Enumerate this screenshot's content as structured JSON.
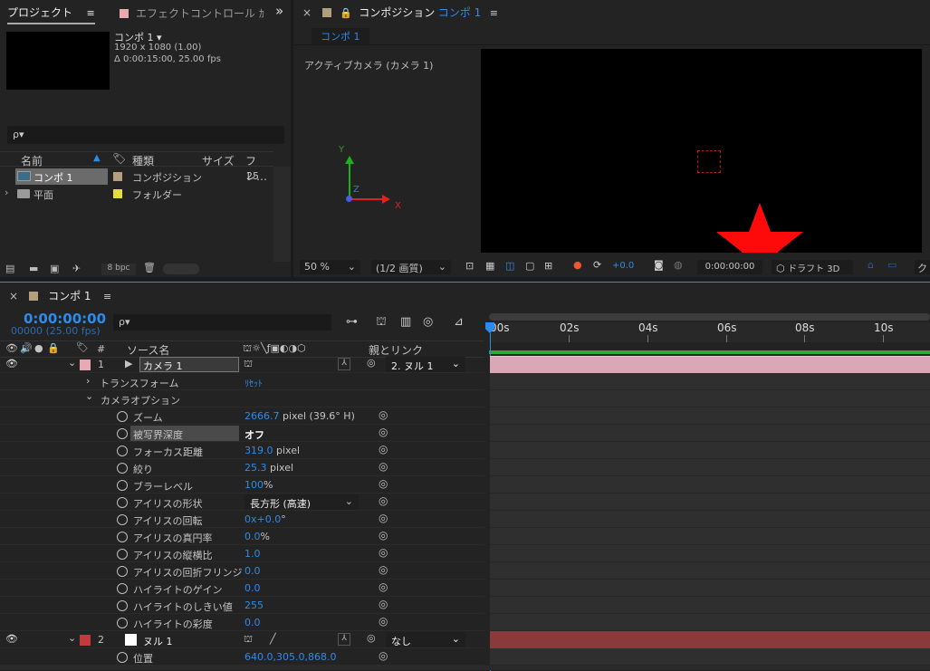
{
  "project": {
    "tab_label": "プロジェクト",
    "tab_menu": "≡",
    "effects_tab": "エフェクトコントロール ｶ",
    "expand": "»",
    "comp_name": "コンポ 1 ▾",
    "comp_size": "1920 x 1080 (1.00)",
    "comp_duration": "Δ 0:00:15:00, 25.00 fps",
    "search_placeholder": "ρ▾",
    "columns": {
      "name": "名前",
      "type": "種類",
      "size": "サイズ",
      "frame": "フレ…"
    },
    "items": [
      {
        "name": "コンポ 1",
        "type": "コンポジション",
        "frame": "25",
        "swatch": "#b39f7b"
      },
      {
        "name": "平面",
        "type": "フォルダー",
        "frame": "",
        "swatch": "#e6dc3e"
      }
    ],
    "bpc": "8 bpc"
  },
  "composition": {
    "close": "×",
    "tab_label": "コンポジション",
    "tab_comp": "コンポ 1",
    "tab_menu": "≡",
    "breadcrumb": "コンポ 1",
    "camera_label": "アクティブカメラ (カメラ 1)",
    "axis_y": "Y",
    "axis_z": "Z",
    "axis_x": "X",
    "zoom": "50 %",
    "resolution": "(1/2 画質)",
    "exposure": "+0.0",
    "timecode": "0:00:00:00",
    "renderer": "ドラフト 3D",
    "last_btn": "ク"
  },
  "timeline": {
    "close": "×",
    "tab_label": "コンポ 1",
    "tab_menu": "≡",
    "timecode": "0:00:00:00",
    "frames": "00000 (25.00 fps)",
    "search_placeholder": "ρ▾",
    "col_num": "#",
    "col_source": "ソース名",
    "col_parent": "親とリンク",
    "ruler": [
      "00s",
      "02s",
      "04s",
      "06s",
      "08s",
      "10s"
    ],
    "layer1": {
      "num": "1",
      "name": "カメラ 1",
      "parent": "2. ヌル 1",
      "color": "#e9a9b3"
    },
    "transform": "トランスフォーム",
    "reset": "ﾘｾｯﾄ",
    "camera_options": "カメラオプション",
    "props": [
      {
        "name": "ズーム",
        "value": "2666.7",
        "unit": " pixel (39.6° H)"
      },
      {
        "name": "被写界深度",
        "value": "オフ",
        "unit": ""
      },
      {
        "name": "フォーカス距離",
        "value": "319.0",
        "unit": " pixel"
      },
      {
        "name": "絞り",
        "value": "25.3",
        "unit": " pixel"
      },
      {
        "name": "ブラーレベル",
        "value": "100",
        "unit": "%"
      },
      {
        "name": "アイリスの形状",
        "value": "長方形 (高速)",
        "unit": ""
      },
      {
        "name": "アイリスの回転",
        "value": "0x+0.0",
        "unit": "°"
      },
      {
        "name": "アイリスの真円率",
        "value": "0.0",
        "unit": "%"
      },
      {
        "name": "アイリスの縦横比",
        "value": "1.0",
        "unit": ""
      },
      {
        "name": "アイリスの回折フリンジ",
        "value": "0.0",
        "unit": ""
      },
      {
        "name": "ハイライトのゲイン",
        "value": "0.0",
        "unit": ""
      },
      {
        "name": "ハイライトのしきい値",
        "value": "255",
        "unit": ""
      },
      {
        "name": "ハイライトの彩度",
        "value": "0.0",
        "unit": ""
      }
    ],
    "layer2": {
      "num": "2",
      "name": "ヌル 1",
      "parent": "なし",
      "color": "#c33a3a"
    },
    "position": {
      "name": "位置",
      "value": "640.0,305.0,868.0"
    }
  },
  "colors": {
    "accent": "#2d8ceb",
    "camera_bar": "#d9a7b5",
    "null_bar": "#8b3a3a",
    "star": "#ff0a0a"
  }
}
